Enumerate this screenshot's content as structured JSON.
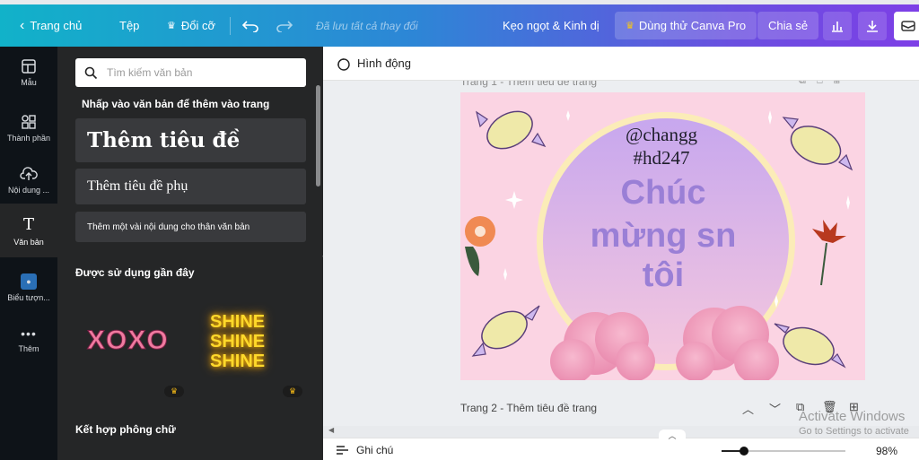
{
  "topbar": {
    "home": "Trang chủ",
    "file": "Tệp",
    "resize": "Đổi cỡ",
    "saved": "Đã lưu tất cả thay đổi",
    "design_title": "Kẹo ngọt & Kinh dị",
    "try_pro": "Dùng thử Canva Pro",
    "share": "Chia sẻ"
  },
  "rail": [
    {
      "label": "Mẫu",
      "icon": "template-icon"
    },
    {
      "label": "Thành phần",
      "icon": "elements-icon"
    },
    {
      "label": "Nội dung ...",
      "icon": "upload-icon"
    },
    {
      "label": "Văn bản",
      "icon": "text-icon"
    },
    {
      "label": "Biểu tượn...",
      "icon": "logo-icon"
    },
    {
      "label": "Thêm",
      "icon": "more-icon"
    }
  ],
  "panel": {
    "search_placeholder": "Tìm kiếm văn bản",
    "hint": "Nhấp vào văn bản để thêm vào trang",
    "add_heading": "Thêm tiêu đề",
    "add_subheading": "Thêm tiêu đề phụ",
    "add_body": "Thêm một vài nội dung cho thân văn bản",
    "recently_used": "Được sử dụng gần đây",
    "sample1": "XOXO",
    "sample2": [
      "SHINE",
      "SHINE",
      "SHINE"
    ],
    "font_combos": "Kết hợp phông chữ"
  },
  "editor": {
    "animate": "Hình động",
    "page1_label": "Trang 1 - Thêm tiêu đề trang",
    "page2_label": "Trang 2 - Thêm tiêu đề trang",
    "design": {
      "handle": "@changg",
      "tag": "#hd247",
      "title_line1": "Chúc",
      "title_line2": "mừng sn",
      "title_line3": "tôi"
    }
  },
  "bottombar": {
    "notes": "Ghi chú",
    "zoom": "98%",
    "zoom_level": 0.18
  },
  "watermark": {
    "line1": "Activate Windows",
    "line2": "Go to Settings to activate"
  },
  "colors": {
    "accent_gradient_start": "#11b2c9",
    "accent_gradient_end": "#7d3fe6",
    "page_bg": "#fbd4e3",
    "title_purple": "#9a7fd6"
  }
}
